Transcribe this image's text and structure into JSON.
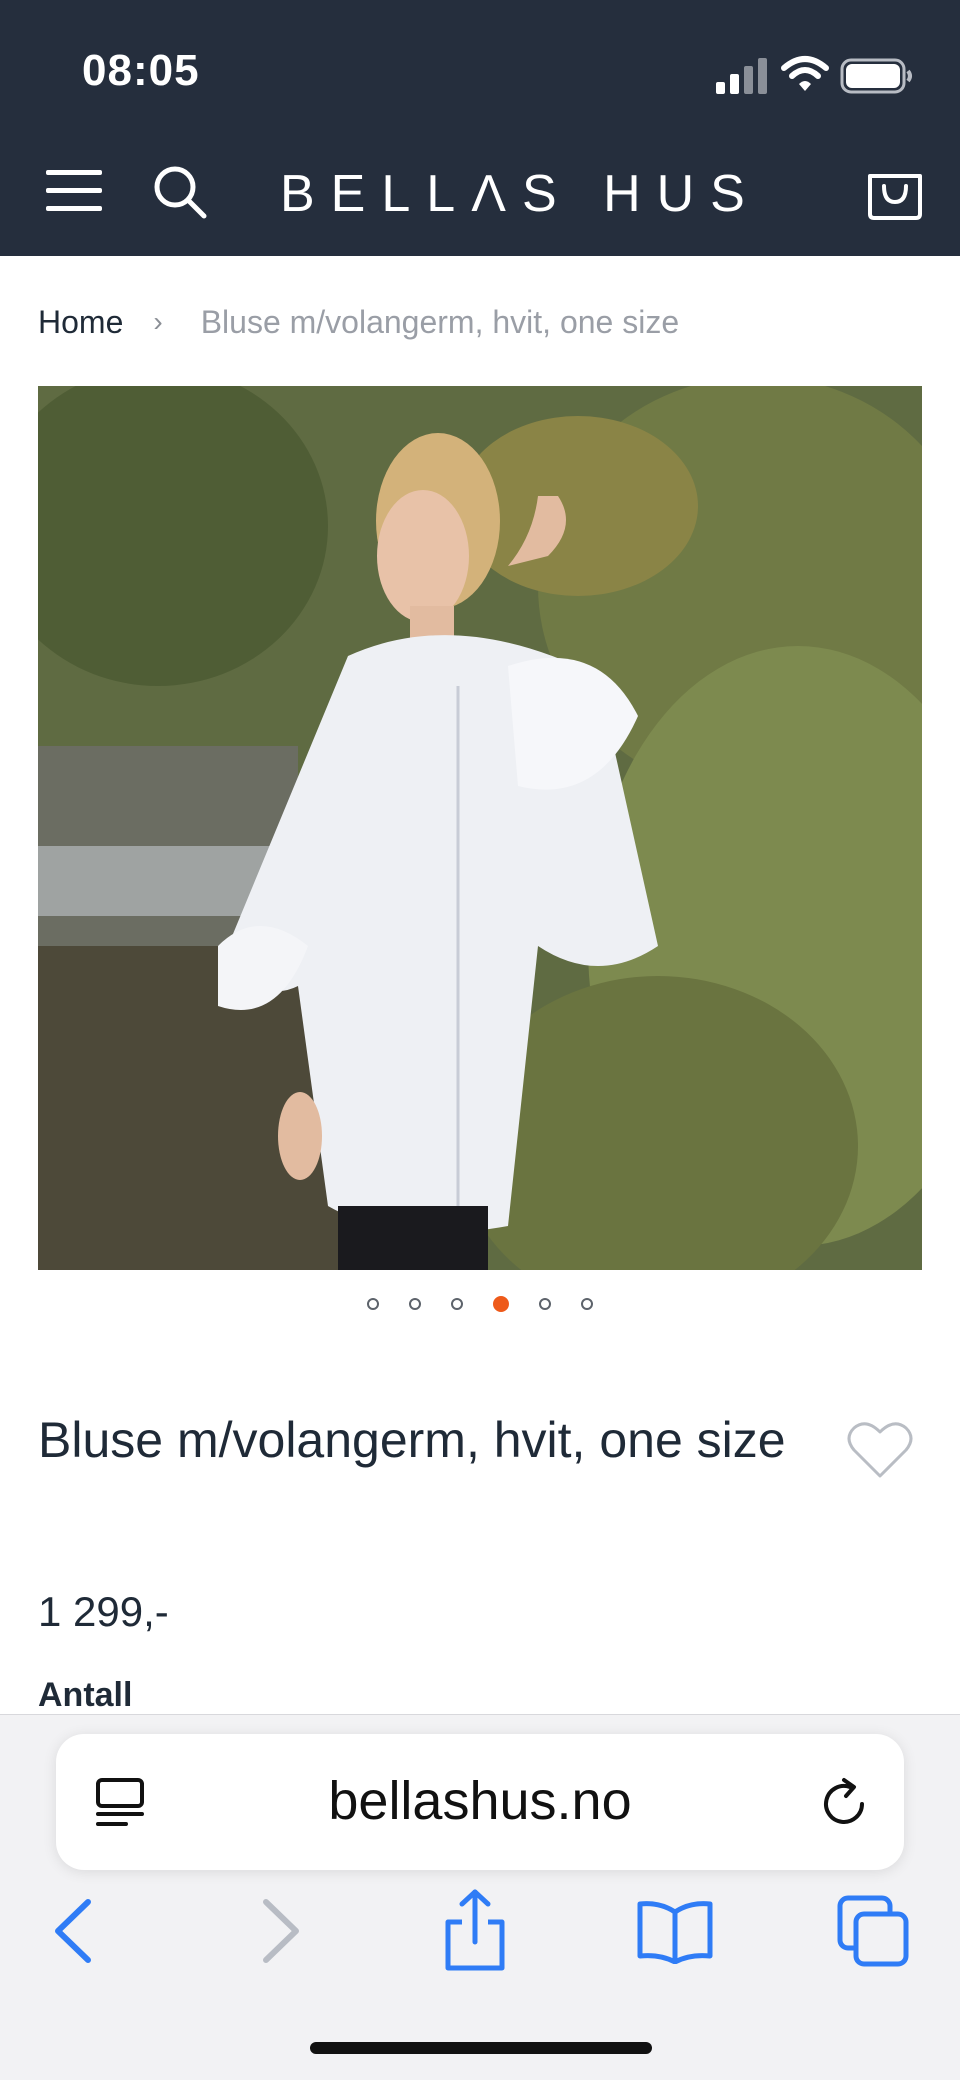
{
  "status_bar": {
    "time": "08:05"
  },
  "header": {
    "logo": "BELLΛS HUS"
  },
  "breadcrumb": {
    "home": "Home",
    "separator": "›",
    "current": "Bluse m/volangerm, hvit, one size"
  },
  "carousel": {
    "total_dots": 6,
    "active_index": 4
  },
  "product": {
    "title": "Bluse m/volangerm, hvit, one size",
    "price": "1 299,-",
    "quantity_label": "Antall"
  },
  "browser": {
    "url": "bellashus.no"
  },
  "colors": {
    "header_bg": "#252e3d",
    "accent": "#ee5a1a",
    "safari_blue": "#2f7cf6"
  },
  "icons": [
    "hamburger-menu-icon",
    "search-icon",
    "cart-icon",
    "heart-icon",
    "reader-icon",
    "reload-icon",
    "back-icon",
    "forward-icon",
    "share-icon",
    "bookmarks-icon",
    "tabs-icon"
  ]
}
